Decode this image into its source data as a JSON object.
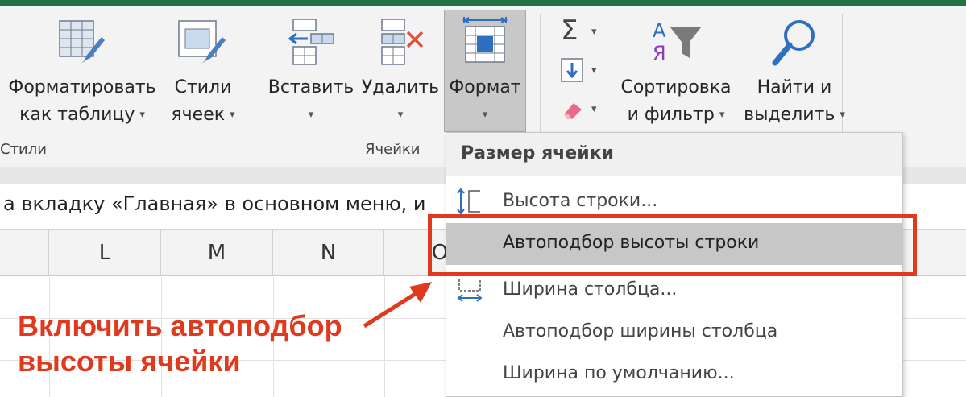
{
  "ribbon": {
    "groups": {
      "styles": {
        "label": "Стили"
      },
      "cells": {
        "label": "Ячейки"
      }
    },
    "buttons": {
      "format_as_table": {
        "line1": "Форматировать",
        "line2": "как таблицу"
      },
      "cell_styles": {
        "line1": "Стили",
        "line2": "ячеек"
      },
      "insert": {
        "label": "Вставить"
      },
      "delete": {
        "label": "Удалить"
      },
      "format": {
        "label": "Формат"
      },
      "sort_filter": {
        "line1": "Сортировка",
        "line2": "и фильтр"
      },
      "find_select": {
        "line1": "Найти и",
        "line2": "выделить"
      }
    },
    "caret": "▾"
  },
  "formula_bar": {
    "text": "а вкладку «Главная» в основном меню, и"
  },
  "columns": [
    "L",
    "M",
    "N",
    "O"
  ],
  "format_menu": {
    "header": "Размер ячейки",
    "items": [
      {
        "label": "Высота строки...",
        "icon": "row-height-icon",
        "highlighted": false
      },
      {
        "label": "Автоподбор высоты строки",
        "icon": "",
        "highlighted": true
      },
      {
        "label": "Ширина столбца...",
        "icon": "column-width-icon",
        "highlighted": false
      },
      {
        "label": "Автоподбор ширины столбца",
        "icon": "",
        "highlighted": false
      },
      {
        "label": "Ширина по умолчанию...",
        "icon": "",
        "highlighted": false
      }
    ]
  },
  "annotation": {
    "line1": "Включить автоподбор",
    "line2": "высоты ячейки"
  },
  "colors": {
    "accent_green": "#217346",
    "annotation_red": "#e03a1e",
    "highlight_gray": "#c7c7c7"
  }
}
